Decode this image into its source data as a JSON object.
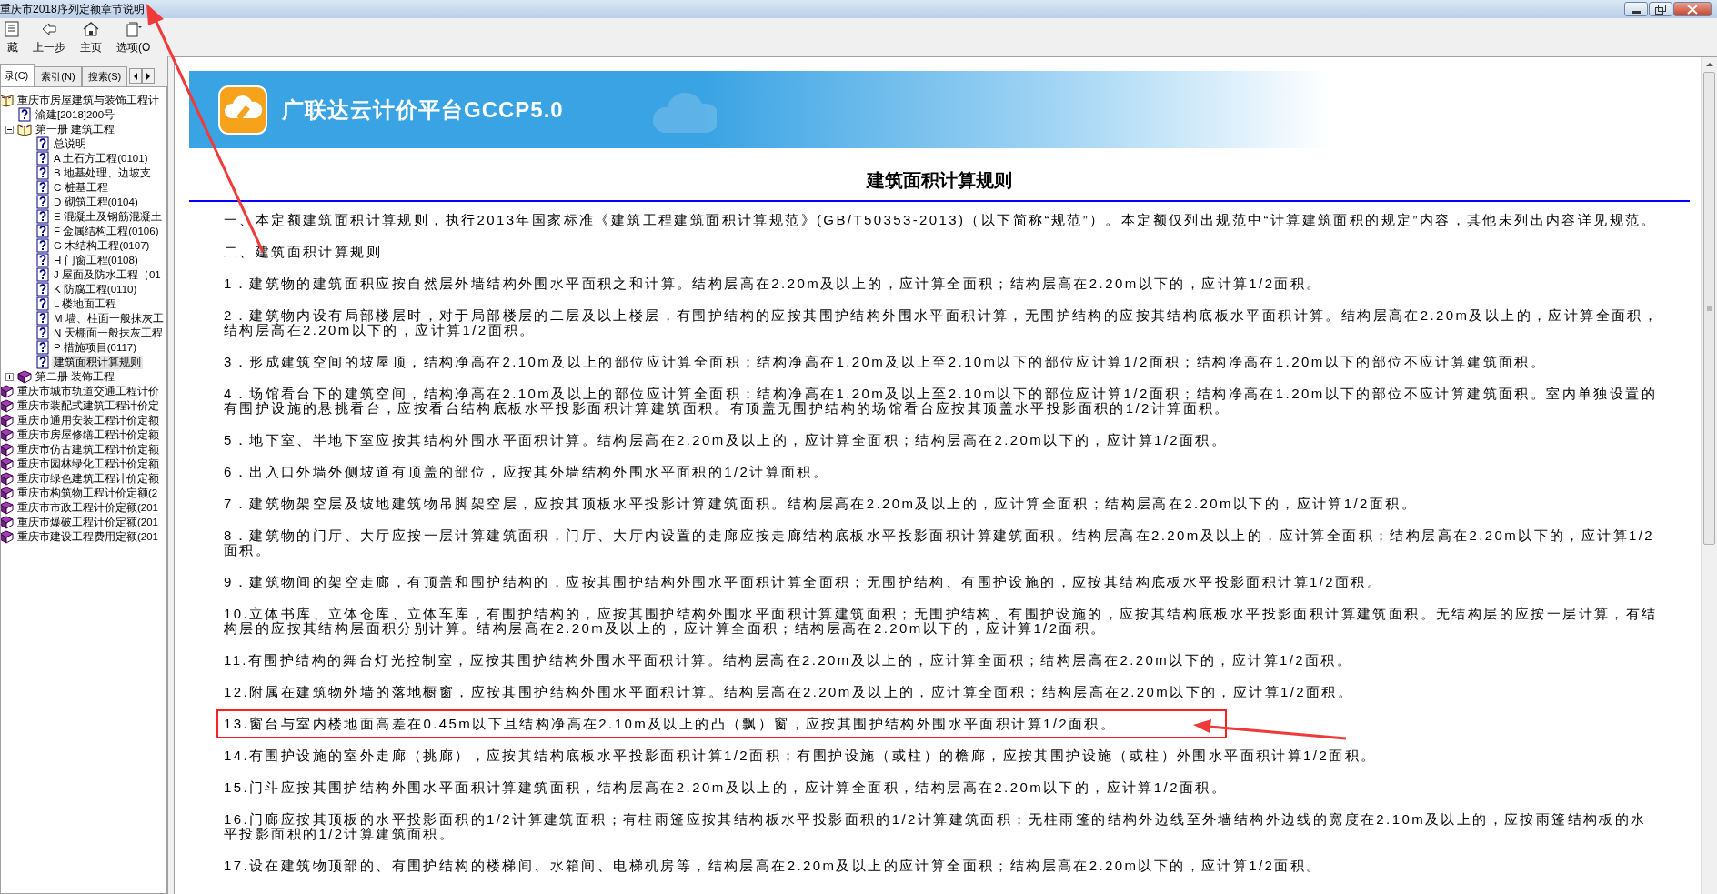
{
  "window": {
    "title": "重庆市2018序列定额章节说明"
  },
  "toolbar": [
    {
      "label": "藏",
      "kind": "hide"
    },
    {
      "label": "上一步",
      "kind": "back"
    },
    {
      "label": "主页",
      "kind": "home"
    },
    {
      "label": "选项(O",
      "kind": "options"
    }
  ],
  "nav_tabs": [
    {
      "label": "录(C)",
      "selected": true
    },
    {
      "label": "索引(N)",
      "selected": false
    },
    {
      "label": "搜索(S)",
      "selected": false
    }
  ],
  "tree": [
    {
      "label": "重庆市房屋建筑与装饰工程计",
      "kind": "book",
      "expanded": true,
      "selected": false,
      "children": [
        {
          "label": "渝建[2018]200号",
          "kind": "page",
          "selected": false
        },
        {
          "label": "第一册 建筑工程",
          "kind": "book",
          "expanded": true,
          "selected": false,
          "children": [
            {
              "label": "总说明",
              "kind": "page",
              "selected": false
            },
            {
              "label": "A 土石方工程(0101)",
              "kind": "page",
              "selected": false
            },
            {
              "label": "B 地基处理、边坡支",
              "kind": "page",
              "selected": false
            },
            {
              "label": "C 桩基工程",
              "kind": "page",
              "selected": false
            },
            {
              "label": "D 砌筑工程(0104)",
              "kind": "page",
              "selected": false
            },
            {
              "label": "E 混凝土及钢筋混凝土",
              "kind": "page",
              "selected": false
            },
            {
              "label": "F 金属结构工程(0106)",
              "kind": "page",
              "selected": false
            },
            {
              "label": "G 木结构工程(0107)",
              "kind": "page",
              "selected": false
            },
            {
              "label": "H 门窗工程(0108)",
              "kind": "page",
              "selected": false
            },
            {
              "label": "J 屋面及防水工程（01",
              "kind": "page",
              "selected": false
            },
            {
              "label": "K 防腐工程(0110)",
              "kind": "page",
              "selected": false
            },
            {
              "label": "L 楼地面工程",
              "kind": "page",
              "selected": false
            },
            {
              "label": "M 墙、柱面一般抹灰工",
              "kind": "page",
              "selected": false
            },
            {
              "label": "N 天棚面一般抹灰工程",
              "kind": "page",
              "selected": false
            },
            {
              "label": "P 措施项目(0117)",
              "kind": "page",
              "selected": false
            },
            {
              "label": "建筑面积计算规则",
              "kind": "page",
              "selected": true
            }
          ]
        },
        {
          "label": "第二册 装饰工程",
          "kind": "book",
          "expanded": false,
          "selected": false
        }
      ]
    },
    {
      "label": "重庆市城市轨道交通工程计价",
      "kind": "book",
      "expanded": false,
      "selected": false
    },
    {
      "label": "重庆市装配式建筑工程计价定",
      "kind": "book",
      "expanded": false,
      "selected": false
    },
    {
      "label": "重庆市通用安装工程计价定额",
      "kind": "book",
      "expanded": false,
      "selected": false
    },
    {
      "label": "重庆市房屋修缮工程计价定额",
      "kind": "book",
      "expanded": false,
      "selected": false
    },
    {
      "label": "重庆市仿古建筑工程计价定额",
      "kind": "book",
      "expanded": false,
      "selected": false
    },
    {
      "label": "重庆市园林绿化工程计价定额",
      "kind": "book",
      "expanded": false,
      "selected": false
    },
    {
      "label": "重庆市绿色建筑工程计价定额",
      "kind": "book",
      "expanded": false,
      "selected": false
    },
    {
      "label": "重庆市构筑物工程计价定额(2",
      "kind": "book",
      "expanded": false,
      "selected": false
    },
    {
      "label": "重庆市市政工程计价定额(201",
      "kind": "book",
      "expanded": false,
      "selected": false
    },
    {
      "label": "重庆市爆破工程计价定额(201",
      "kind": "book",
      "expanded": false,
      "selected": false
    },
    {
      "label": "重庆市建设工程费用定额(201",
      "kind": "book",
      "expanded": false,
      "selected": false
    }
  ],
  "document": {
    "banner_title": "广联达云计价平台GCCP5.0",
    "title": "建筑面积计算规则",
    "paragraphs": [
      {
        "text": "一、本定额建筑面积计算规则，执行2013年国家标准《建筑工程建筑面积计算规范》(GB/T50353-2013)（以下简称“规范”）。本定额仅列出规范中“计算建筑面积的规定”内容，其他未列出内容详见规范。",
        "highlighted": false
      },
      {
        "text": "二、建筑面积计算规则",
        "highlighted": false
      },
      {
        "text": "1．建筑物的建筑面积应按自然层外墙结构外围水平面积之和计算。结构层高在2.20m及以上的，应计算全面积；结构层高在2.20m以下的，应计算1/2面积。",
        "highlighted": false
      },
      {
        "text": "2．建筑物内设有局部楼层时，对于局部楼层的二层及以上楼层，有围护结构的应按其围护结构外围水平面积计算，无围护结构的应按其结构底板水平面积计算。结构层高在2.20m及以上的，应计算全面积，结构层高在2.20m以下的，应计算1/2面积。",
        "highlighted": false
      },
      {
        "text": "3．形成建筑空间的坡屋顶，结构净高在2.10m及以上的部位应计算全面积；结构净高在1.20m及以上至2.10m以下的部位应计算1/2面积；结构净高在1.20m以下的部位不应计算建筑面积。",
        "highlighted": false
      },
      {
        "text": "4．场馆看台下的建筑空间，结构净高在2.10m及以上的部位应计算全面积；结构净高在1.20m及以上至2.10m以下的部位应计算1/2面积；结构净高在1.20m以下的部位不应计算建筑面积。室内单独设置的有围护设施的悬挑看台，应按看台结构底板水平投影面积计算建筑面积。有顶盖无围护结构的场馆看台应按其顶盖水平投影面积的1/2计算面积。",
        "highlighted": false
      },
      {
        "text": "5．地下室、半地下室应按其结构外围水平面积计算。结构层高在2.20m及以上的，应计算全面积；结构层高在2.20m以下的，应计算1/2面积。",
        "highlighted": false
      },
      {
        "text": "6．出入口外墙外侧坡道有顶盖的部位，应按其外墙结构外围水平面积的1/2计算面积。",
        "highlighted": false
      },
      {
        "text": "7．建筑物架空层及坡地建筑物吊脚架空层，应按其顶板水平投影计算建筑面积。结构层高在2.20m及以上的，应计算全面积；结构层高在2.20m以下的，应计算1/2面积。",
        "highlighted": false
      },
      {
        "text": "8．建筑物的门厅、大厅应按一层计算建筑面积，门厅、大厅内设置的走廊应按走廊结构底板水平投影面积计算建筑面积。结构层高在2.20m及以上的，应计算全面积；结构层高在2.20m以下的，应计算1/2面积。",
        "highlighted": false
      },
      {
        "text": "9．建筑物间的架空走廊，有顶盖和围护结构的，应按其围护结构外围水平面积计算全面积；无围护结构、有围护设施的，应按其结构底板水平投影面积计算1/2面积。",
        "highlighted": false
      },
      {
        "text": "10.立体书库、立体仓库、立体车库，有围护结构的，应按其围护结构外围水平面积计算建筑面积；无围护结构、有围护设施的，应按其结构底板水平投影面积计算建筑面积。无结构层的应按一层计算，有结构层的应按其结构层面积分别计算。结构层高在2.20m及以上的，应计算全面积；结构层高在2.20m以下的，应计算1/2面积。",
        "highlighted": false
      },
      {
        "text": "11.有围护结构的舞台灯光控制室，应按其围护结构外围水平面积计算。结构层高在2.20m及以上的，应计算全面积；结构层高在2.20m以下的，应计算1/2面积。",
        "highlighted": false
      },
      {
        "text": "12.附属在建筑物外墙的落地橱窗，应按其围护结构外围水平面积计算。结构层高在2.20m及以上的，应计算全面积；结构层高在2.20m以下的，应计算1/2面积。",
        "highlighted": false
      },
      {
        "text": "13.窗台与室内楼地面高差在0.45m以下且结构净高在2.10m及以上的凸（飘）窗，应按其围护结构外围水平面积计算1/2面积。",
        "highlighted": true
      },
      {
        "text": "14.有围护设施的室外走廊（挑廊），应按其结构底板水平投影面积计算1/2面积；有围护设施（或柱）的檐廊，应按其围护设施（或柱）外围水平面积计算1/2面积。",
        "highlighted": false
      },
      {
        "text": "15.门斗应按其围护结构外围水平面积计算建筑面积，结构层高在2.20m及以上的，应计算全面积，结构层高在2.20m以下的，应计算1/2面积。",
        "highlighted": false
      },
      {
        "text": "16.门廊应按其顶板的水平投影面积的1/2计算建筑面积；有柱雨篷应按其结构板水平投影面积的1/2计算建筑面积；无柱雨篷的结构外边线至外墙结构外边线的宽度在2.10m及以上的，应按雨篷结构板的水平投影面积的1/2计算建筑面积。",
        "highlighted": false
      },
      {
        "text": "17.设在建筑物顶部的、有围护结构的楼梯间、水箱间、电梯机房等，结构层高在2.20m及以上的应计算全面积；结构层高在2.20m以下的，应计算1/2面积。",
        "highlighted": false
      }
    ]
  }
}
